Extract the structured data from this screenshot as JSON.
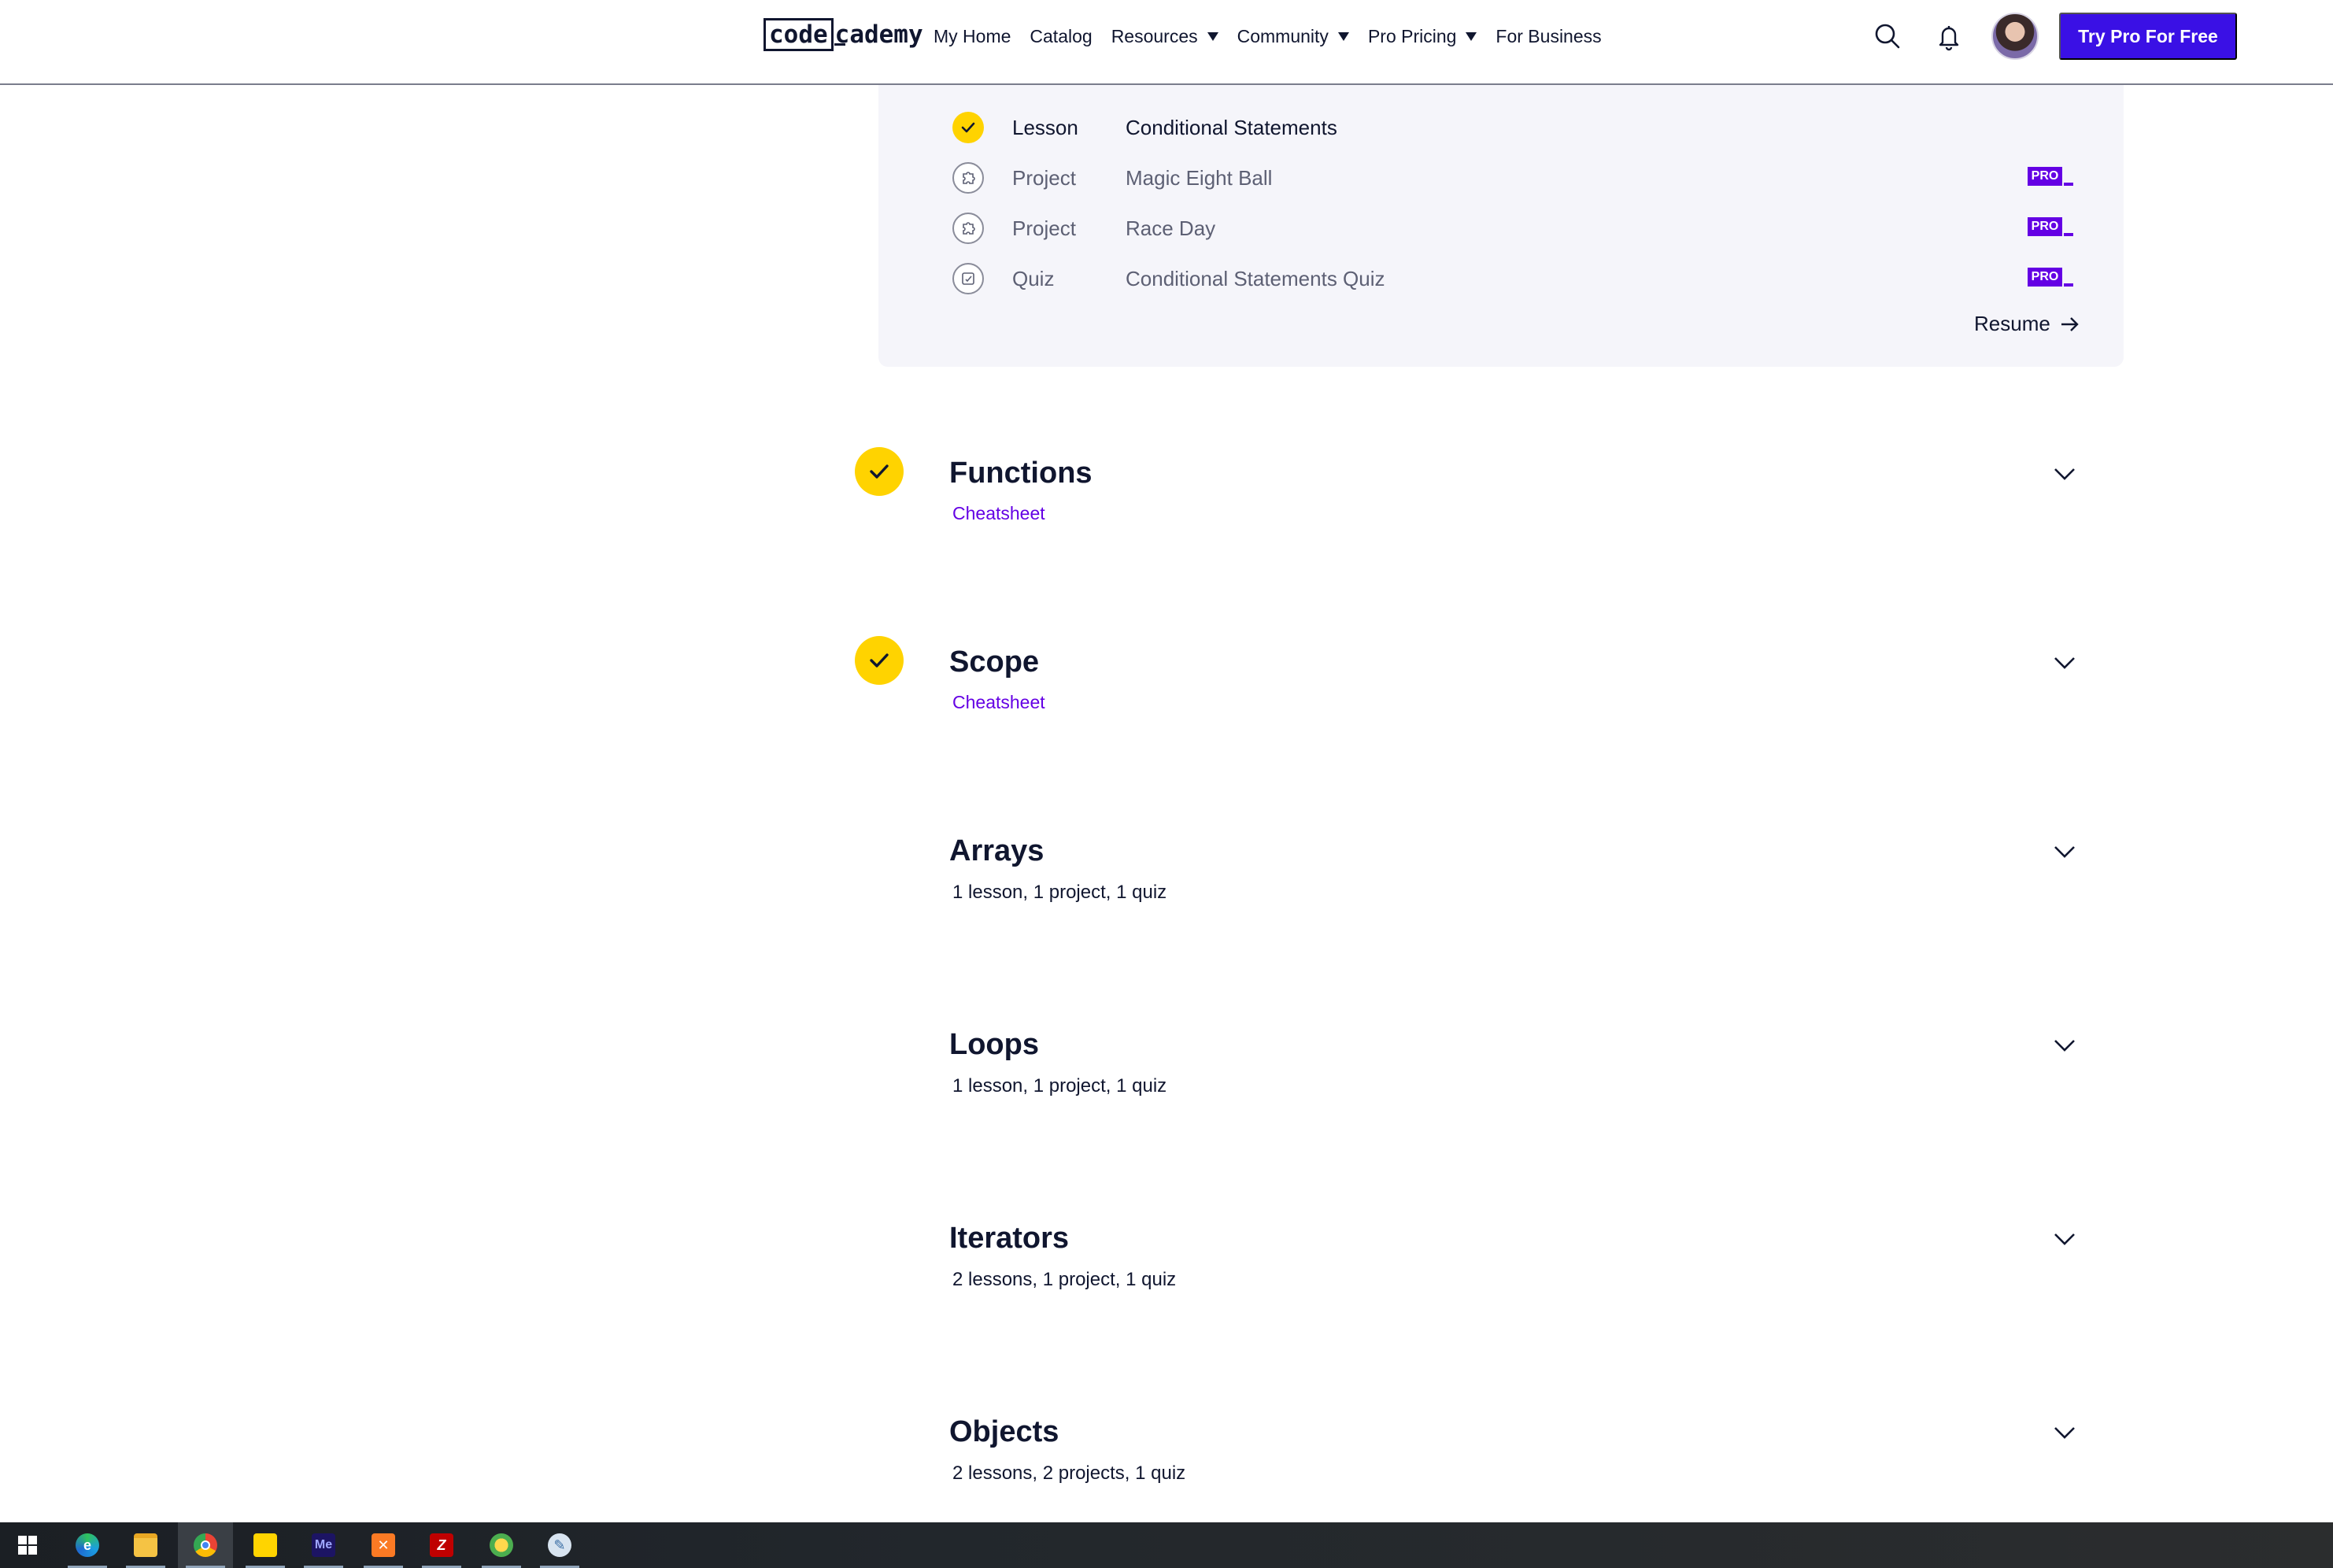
{
  "nav": {
    "logo_code": "code",
    "logo_rest": "cademy",
    "links": [
      {
        "label": "My Home",
        "has_caret": false
      },
      {
        "label": "Catalog",
        "has_caret": false
      },
      {
        "label": "Resources",
        "has_caret": true
      },
      {
        "label": "Community",
        "has_caret": true
      },
      {
        "label": "Pro Pricing",
        "has_caret": true
      },
      {
        "label": "For Business",
        "has_caret": false
      }
    ],
    "cta_label": "Try Pro For Free",
    "icons": [
      "search-icon",
      "bell-icon",
      "avatar"
    ]
  },
  "current_module": {
    "items": [
      {
        "type": "Lesson",
        "title": "Conditional Statements",
        "status": "complete",
        "icon": "check-icon",
        "pro": false
      },
      {
        "type": "Project",
        "title": "Magic Eight Ball",
        "status": "locked",
        "icon": "puzzle-icon",
        "pro": true
      },
      {
        "type": "Project",
        "title": "Race Day",
        "status": "locked",
        "icon": "puzzle-icon",
        "pro": true
      },
      {
        "type": "Quiz",
        "title": "Conditional Statements Quiz",
        "status": "locked",
        "icon": "quiz-icon",
        "pro": true
      }
    ],
    "pro_badge": "PRO",
    "resume_label": "Resume"
  },
  "modules": [
    {
      "title": "Functions",
      "completed": true,
      "link": "Cheatsheet",
      "summary": null
    },
    {
      "title": "Scope",
      "completed": true,
      "link": "Cheatsheet",
      "summary": null
    },
    {
      "title": "Arrays",
      "completed": false,
      "link": null,
      "summary": "1 lesson, 1 project, 1 quiz"
    },
    {
      "title": "Loops",
      "completed": false,
      "link": null,
      "summary": "1 lesson, 1 project, 1 quiz"
    },
    {
      "title": "Iterators",
      "completed": false,
      "link": null,
      "summary": "2 lessons, 1 project, 1 quiz"
    },
    {
      "title": "Objects",
      "completed": false,
      "link": null,
      "summary": "2 lessons, 2 projects, 1 quiz"
    }
  ],
  "taskbar": {
    "apps": [
      "windows-start-icon",
      "edge-icon",
      "file-explorer-icon",
      "chrome-icon",
      "sticky-notes-icon",
      "media-encoder-icon",
      "xampp-icon",
      "filezilla-icon",
      "app-icon",
      "paint-icon"
    ]
  },
  "colors": {
    "brand_purple": "#3a10e5",
    "pro_purple": "#6400e4",
    "check_yellow": "#ffd300",
    "text_navy": "#10162f",
    "panel_bg": "#f5f5fa"
  }
}
